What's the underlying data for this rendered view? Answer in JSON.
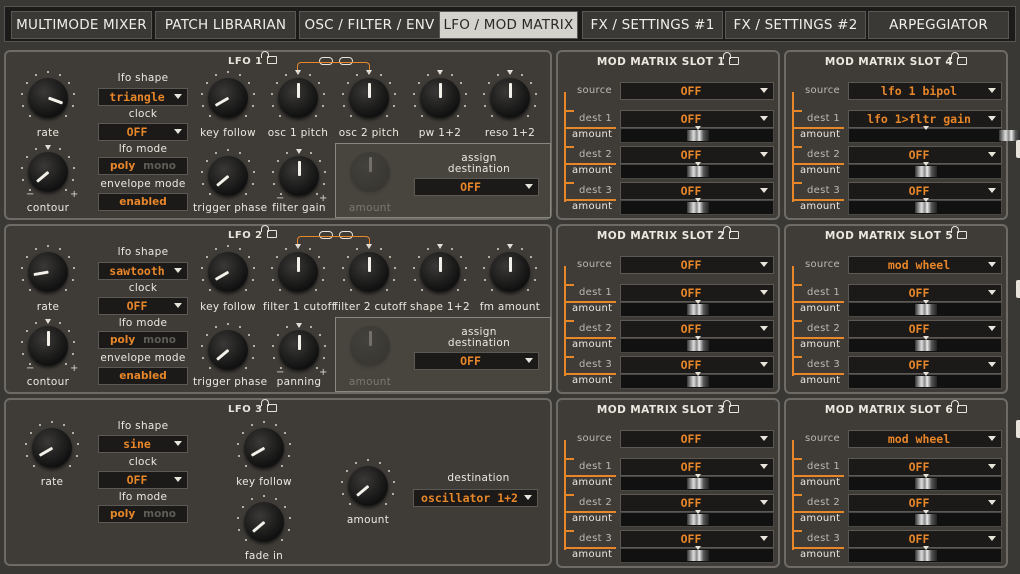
{
  "tabs": [
    {
      "label": "MULTIMODE MIXER"
    },
    {
      "label": "PATCH LIBRARIAN"
    },
    {
      "label": "OSC / FILTER / ENV"
    },
    {
      "label": "LFO / MOD MATRIX",
      "active": true
    },
    {
      "label": "FX / SETTINGS #1"
    },
    {
      "label": "FX / SETTINGS #2"
    },
    {
      "label": "ARPEGGIATOR"
    }
  ],
  "lfo1": {
    "title": "LFO 1",
    "rate": "rate",
    "contour": "contour",
    "shape_label": "lfo shape",
    "shape_value": "triangle",
    "clock_label": "clock",
    "clock_value": "OFF",
    "mode_label": "lfo mode",
    "mode_on": "poly",
    "mode_off": "mono",
    "env_label": "envelope mode",
    "env_value": "enabled",
    "key_follow": "key follow",
    "trigger_phase": "trigger phase",
    "filter_gain": "filter gain",
    "dest_knobs": [
      "osc 1 pitch",
      "osc 2 pitch",
      "pw 1+2",
      "reso 1+2"
    ],
    "amount": "amount",
    "assign_label": "assign destination",
    "assign_value": "OFF"
  },
  "lfo2": {
    "title": "LFO 2",
    "rate": "rate",
    "contour": "contour",
    "shape_label": "lfo shape",
    "shape_value": "sawtooth",
    "clock_label": "clock",
    "clock_value": "OFF",
    "mode_label": "lfo mode",
    "mode_on": "poly",
    "mode_off": "mono",
    "env_label": "envelope mode",
    "env_value": "enabled",
    "key_follow": "key follow",
    "trigger_phase": "trigger phase",
    "panning": "panning",
    "dest_knobs": [
      "filter 1 cutoff",
      "filter 2 cutoff",
      "shape 1+2",
      "fm amount"
    ],
    "amount": "amount",
    "assign_label": "assign destination",
    "assign_value": "OFF"
  },
  "lfo3": {
    "title": "LFO 3",
    "rate": "rate",
    "shape_label": "lfo shape",
    "shape_value": "sine",
    "clock_label": "clock",
    "clock_value": "OFF",
    "mode_label": "lfo mode",
    "mode_on": "poly",
    "mode_off": "mono",
    "key_follow": "key follow",
    "fade_in": "fade in",
    "amount": "amount",
    "dest_label": "destination",
    "dest_value": "oscillator 1+2"
  },
  "mod_matrix": [
    {
      "title": "MOD MATRIX SLOT 1",
      "source_label": "source",
      "source": "OFF",
      "dests": [
        {
          "label": "dest 1",
          "value": "OFF"
        },
        {
          "label": "dest 2",
          "value": "OFF"
        },
        {
          "label": "dest 3",
          "value": "OFF"
        }
      ],
      "amount_label": "amount",
      "amounts": [
        0,
        0,
        0
      ]
    },
    {
      "title": "MOD MATRIX SLOT 2",
      "source_label": "source",
      "source": "OFF",
      "dests": [
        {
          "label": "dest 1",
          "value": "OFF"
        },
        {
          "label": "dest 2",
          "value": "OFF"
        },
        {
          "label": "dest 3",
          "value": "OFF"
        }
      ],
      "amount_label": "amount",
      "amounts": [
        0,
        0,
        0
      ]
    },
    {
      "title": "MOD MATRIX SLOT 3",
      "source_label": "source",
      "source": "OFF",
      "dests": [
        {
          "label": "dest 1",
          "value": "OFF"
        },
        {
          "label": "dest 2",
          "value": "OFF"
        },
        {
          "label": "dest 3",
          "value": "OFF"
        }
      ],
      "amount_label": "amount",
      "amounts": [
        0,
        0,
        0
      ]
    },
    {
      "title": "MOD MATRIX SLOT 4",
      "source_label": "source",
      "source": "lfo 1 bipol",
      "dests": [
        {
          "label": "dest 1",
          "value": "lfo 1>fltr gain"
        },
        {
          "label": "dest 2",
          "value": "OFF"
        },
        {
          "label": "dest 3",
          "value": "OFF"
        }
      ],
      "amount_label": "amount",
      "amounts": [
        1,
        0,
        0
      ]
    },
    {
      "title": "MOD MATRIX SLOT 5",
      "source_label": "source",
      "source": "mod wheel",
      "dests": [
        {
          "label": "dest 1",
          "value": "OFF"
        },
        {
          "label": "dest 2",
          "value": "OFF"
        },
        {
          "label": "dest 3",
          "value": "OFF"
        }
      ],
      "amount_label": "amount",
      "amounts": [
        0,
        0,
        0
      ]
    },
    {
      "title": "MOD MATRIX SLOT 6",
      "source_label": "source",
      "source": "mod wheel",
      "dests": [
        {
          "label": "dest 1",
          "value": "OFF"
        },
        {
          "label": "dest 2",
          "value": "OFF"
        },
        {
          "label": "dest 3",
          "value": "OFF"
        }
      ],
      "amount_label": "amount",
      "amounts": [
        0,
        0,
        0
      ]
    }
  ],
  "colors": {
    "accent": "#e8862a",
    "panel": "#3f3c38",
    "display": "#1b1a18"
  },
  "icons": {
    "lock": "lock-icon",
    "dropdown": "chevron-down-icon",
    "link": "chain-link-icon"
  }
}
